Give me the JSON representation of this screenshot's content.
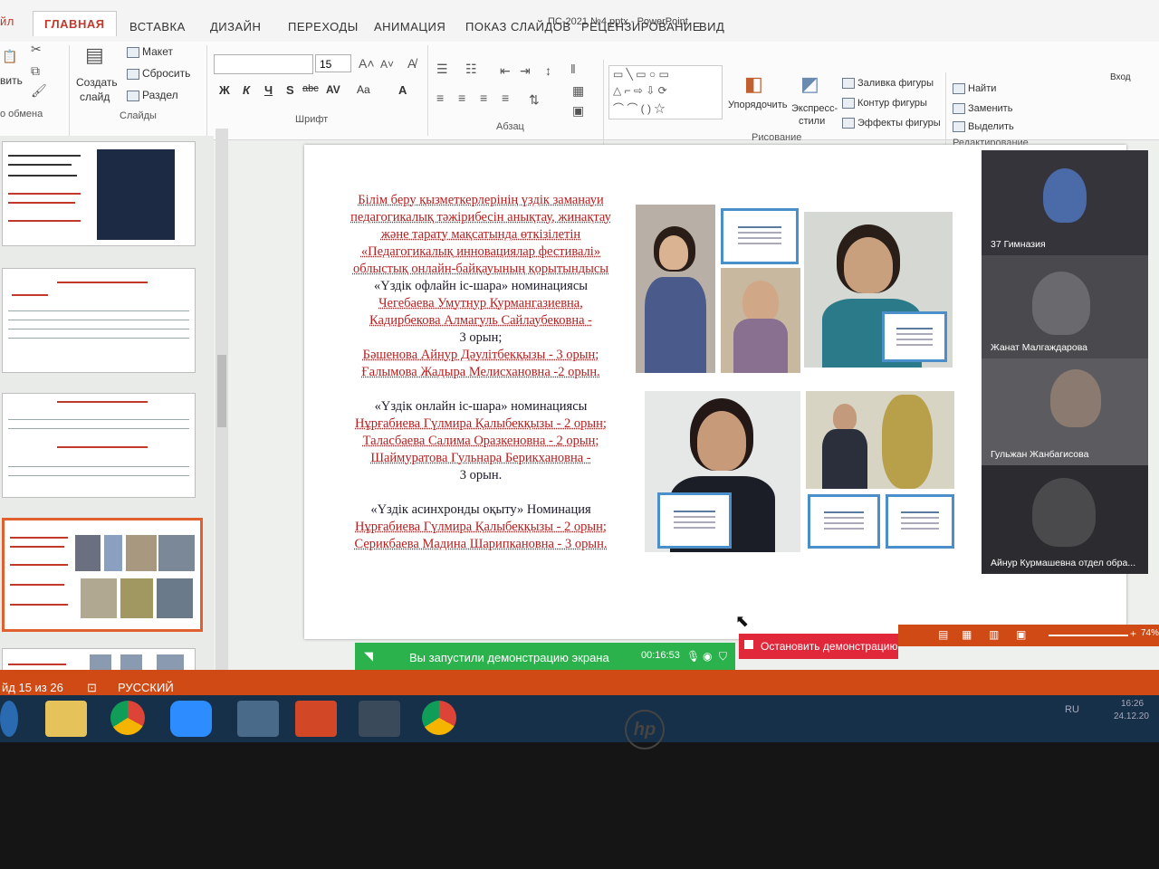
{
  "window": {
    "title": "ПС-2021 №4.pptx - PowerPoint",
    "help": "?",
    "user": "Вход"
  },
  "tabs": [
    "йл",
    "ГЛАВНАЯ",
    "ВСТАВКА",
    "ДИЗАЙН",
    "ПЕРЕХОДЫ",
    "АНИМАЦИЯ",
    "ПОКАЗ СЛАЙДОВ",
    "РЕЦЕНЗИРОВАНИЕ",
    "ВИД"
  ],
  "ribbon": {
    "clipboard": {
      "paste": "вить",
      "label": "о обмена"
    },
    "slides": {
      "create": "Создать",
      "create2": "слайд",
      "layout": "Макет",
      "reset": "Сбросить",
      "section": "Раздел",
      "label": "Слайды"
    },
    "font": {
      "name": "",
      "size": "15",
      "bold": "Ж",
      "italic": "К",
      "underline": "Ч",
      "shadow": "S",
      "strike": "abc",
      "spacing": "AV",
      "case": "Aa",
      "color": "A",
      "label": "Шрифт"
    },
    "paragraph": {
      "label": "Абзац"
    },
    "drawing": {
      "arrange": "Упорядочить",
      "quick": "Экспресс-",
      "quick2": "стили",
      "fill": "Заливка фигуры",
      "outline": "Контур фигуры",
      "effects": "Эффекты фигуры",
      "label": "Рисование"
    },
    "editing": {
      "find": "Найти",
      "replace": "Заменить",
      "select": "Выделить",
      "label": "Редактирование"
    }
  },
  "slide": {
    "intro_lines": [
      "Білім беру қызметкерлерінің үздік заманауи",
      "педагогикалық тәжірибесін анықтау, жинақтау",
      "және тарату мақсатында өткізілетін",
      "«Педагогикалық инновациялар фестивалі»",
      "облыстық онлайн-байқауының қорытындысы"
    ],
    "nom1_title": "«Үздік офлайн іс-шара» номинациясы",
    "nom1_lines": [
      "Чегебаева Умутнур Курмангазиевна,",
      "Кадирбекова Алмагуль Сайлаубековна -",
      "3 орын;",
      "Бәшенова Айнур Дәулітбекқызы - 3 орын;",
      "Ғалымова Жадыра Мелисхановна -2 орын."
    ],
    "nom2_title": "«Үздік онлайн іс-шара» номинациясы",
    "nom2_lines": [
      "Нұрғабиева Гүлмира Қалыбекқызы - 2 орын;",
      "Таласбаева Салима Оразкеновна - 2 орын;",
      "Шаймуратова Гульнара Берикхановна -",
      "3 орын."
    ],
    "nom3_title": "«Үздік асинхронды оқыту» Номинация",
    "nom3_lines": [
      "Нұрғабиева Гүлмира Қалыбекқызы - 2 орын;",
      "Серикбаева Мадина Шарипкановна - 3 орын."
    ],
    "cert_label": "ДИПЛОМ"
  },
  "video": [
    {
      "name": "37 Гимназия",
      "bg": "#34343a"
    },
    {
      "name": "Жанат Малгаждарова",
      "bg": "#4a4a4e"
    },
    {
      "name": "Гульжан Жанбагисова",
      "bg": "#5c5c60"
    },
    {
      "name": "Айнур Курмашевна отдел обра...",
      "bg": "#2c2c30"
    }
  ],
  "status": {
    "slide_counter": "йд 15 из 26",
    "language": "РУССКИЙ",
    "zoom": "74%"
  },
  "share": {
    "message": "Вы запустили демонстрацию экрана",
    "timer": "00:16:53",
    "stop": "Остановить демонстрацию"
  },
  "tray": {
    "lang": "RU",
    "time": "16:26",
    "date": "24.12.20"
  },
  "brand": {
    "accent": "#d04a16",
    "share_green": "#2bb24c",
    "stop_red": "#e0283a",
    "slide_text_red": "#b51f1f"
  }
}
